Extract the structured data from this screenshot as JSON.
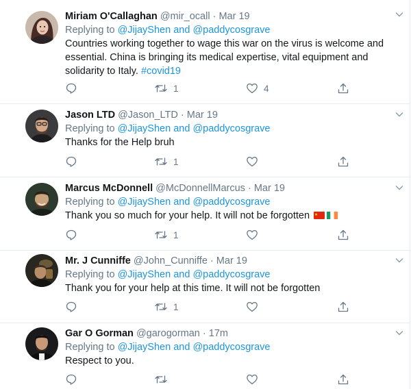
{
  "tweets": [
    {
      "name": "Miriam O'Callaghan",
      "handle": "@mir_ocall",
      "sep": "·",
      "time": "Mar 19",
      "replying_prefix": "Replying to",
      "mention1": "@JijayShen",
      "and": "and",
      "mention2": "@paddycosgrave",
      "text": "Countries working together to wage this war on the virus is welcome and essential. China is bringing its medical expertise, vital equipment and solidarity to Italy.",
      "hashtag": "#covid19",
      "retweets": "1",
      "likes": "4"
    },
    {
      "name": "Jason LTD",
      "handle": "@Jason_LTD",
      "sep": "·",
      "time": "Mar 19",
      "replying_prefix": "Replying to",
      "mention1": "@JijayShen",
      "and": "and",
      "mention2": "@paddycosgrave",
      "text": "Thanks for the Help bruh",
      "retweets": "1"
    },
    {
      "name": "Marcus McDonnell",
      "handle": "@McDonnellMarcus",
      "sep": "·",
      "time": "Mar 19",
      "replying_prefix": "Replying to",
      "mention1": "@JijayShen",
      "and": "and",
      "mention2": "@paddycosgrave",
      "text": "Thank you so much for your help.  It will not be forgotten",
      "retweets": "1"
    },
    {
      "name": "Mr. J Cunniffe",
      "handle": "@John_Cunniffe",
      "sep": "·",
      "time": "Mar 19",
      "replying_prefix": "Replying to",
      "mention1": "@JijayShen",
      "and": "and",
      "mention2": "@paddycosgrave",
      "text": "Thank you for your help at this time. It will not be forgotten",
      "retweets": "1"
    },
    {
      "name": "Gar O Gorman",
      "handle": "@garogorman",
      "sep": "·",
      "time": "17m",
      "replying_prefix": "Replying to",
      "mention1": "@JijayShen",
      "and": "and",
      "mention2": "@paddycosgrave",
      "text": "Respect to you."
    }
  ],
  "icons": {
    "reply": "reply-icon",
    "retweet": "retweet-icon",
    "like": "heart-icon",
    "share": "share-icon",
    "menu": "chevron-down-icon",
    "flags": [
      "china-flag-icon",
      "ireland-flag-icon"
    ]
  },
  "colors": {
    "link": "#1b95e0",
    "secondary_text": "#657786",
    "primary_text": "#14171a",
    "divider": "#e6ecf0"
  }
}
